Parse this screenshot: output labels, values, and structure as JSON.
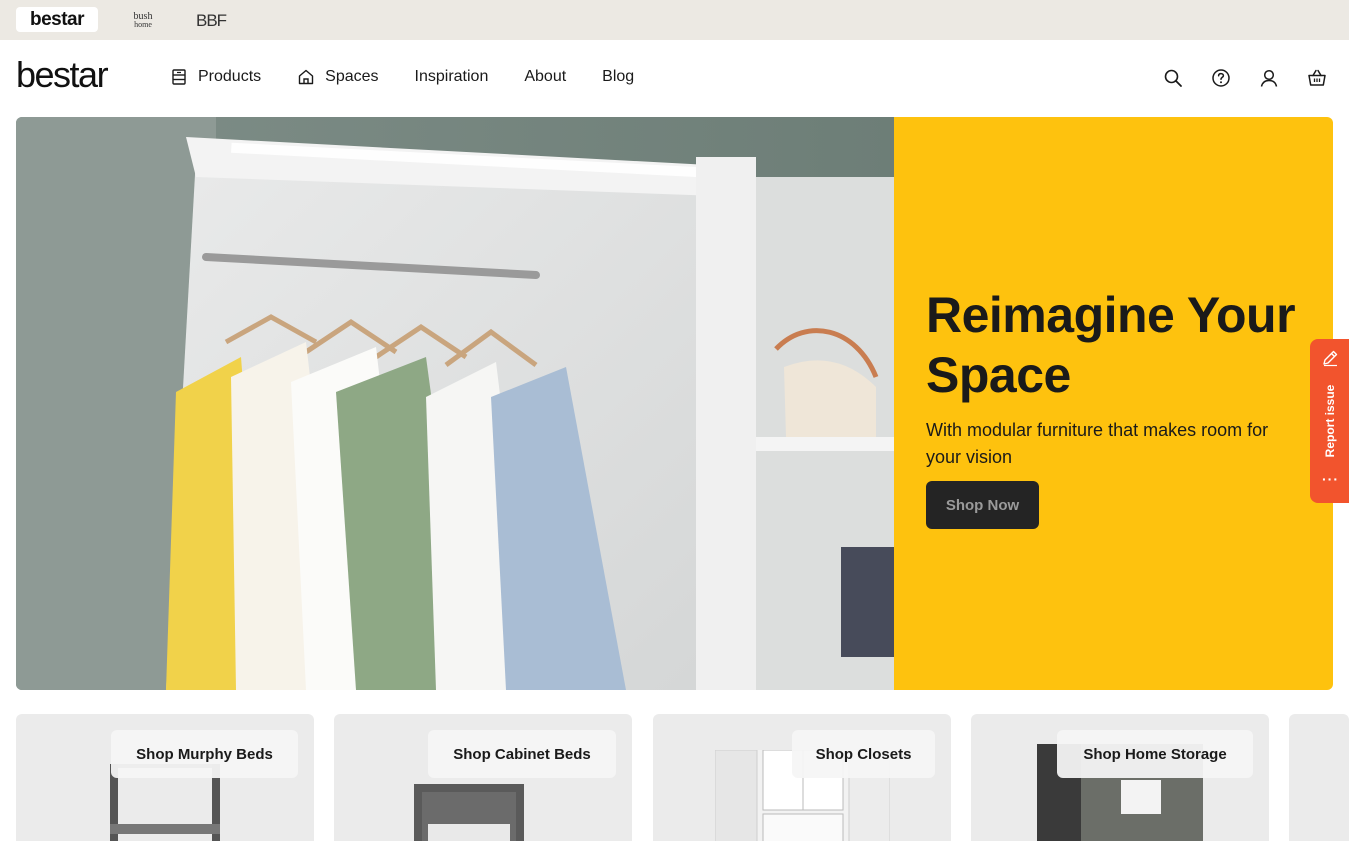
{
  "brand_bar": {
    "brands": [
      {
        "name": "bestar",
        "label": "bestar"
      },
      {
        "name": "bush home",
        "label": "bush home"
      },
      {
        "name": "BBF",
        "label": "BBF"
      }
    ]
  },
  "header": {
    "logo": "bestar",
    "nav": [
      {
        "label": "Products",
        "icon": "grid-box-icon"
      },
      {
        "label": "Spaces",
        "icon": "house-icon"
      },
      {
        "label": "Inspiration",
        "icon": null
      },
      {
        "label": "About",
        "icon": null
      },
      {
        "label": "Blog",
        "icon": null
      }
    ],
    "icons": [
      "search-icon",
      "help-icon",
      "account-icon",
      "cart-icon"
    ]
  },
  "hero": {
    "title": "Reimagine Your Space",
    "subtitle": "With modular furniture that makes room for your vision",
    "cta_label": "Shop Now",
    "panel_color": "#fec20e"
  },
  "report_issue": {
    "label": "Report issue",
    "color": "#f2542d"
  },
  "categories": [
    {
      "label": "Shop Murphy Beds"
    },
    {
      "label": "Shop Cabinet Beds"
    },
    {
      "label": "Shop Closets"
    },
    {
      "label": "Shop Home Storage"
    }
  ]
}
